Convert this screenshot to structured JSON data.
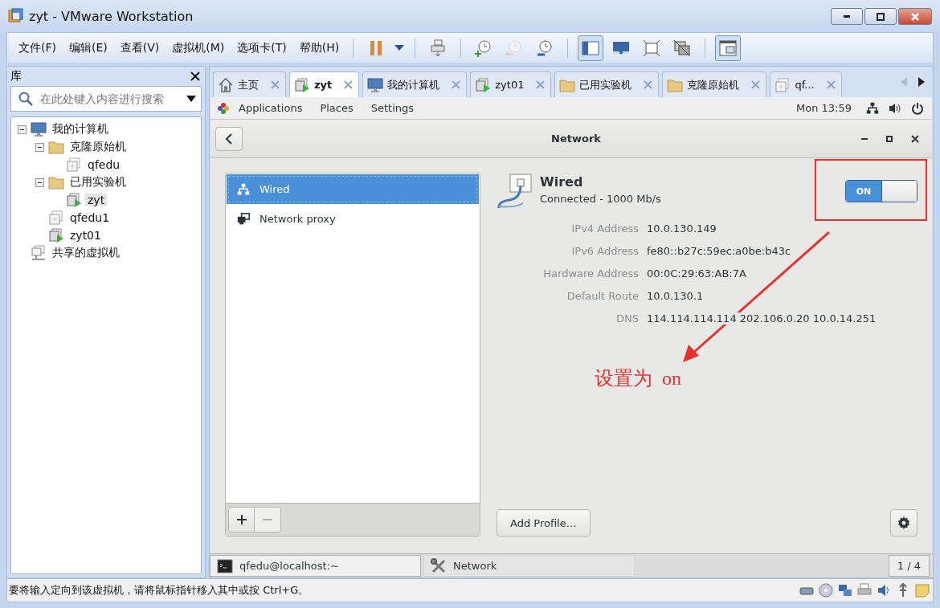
{
  "window": {
    "title": "zyt - VMware Workstation"
  },
  "menu": [
    "文件(F)",
    "编辑(E)",
    "查看(V)",
    "虚拟机(M)",
    "选项卡(T)",
    "帮助(H)"
  ],
  "toolbar": [
    [
      {
        "kind": "pause",
        "pressed": false,
        "disabled": false
      },
      {
        "kind": "dropdown",
        "pressed": false,
        "disabled": false
      }
    ],
    [
      {
        "kind": "send-keys",
        "pressed": false,
        "disabled": false
      }
    ],
    [
      {
        "kind": "snapshot-take",
        "pressed": false,
        "disabled": false
      },
      {
        "kind": "snapshot-revert",
        "pressed": false,
        "disabled": true
      },
      {
        "kind": "snapshot-manager",
        "pressed": false,
        "disabled": false
      }
    ],
    [
      {
        "kind": "library-view",
        "pressed": true,
        "disabled": false
      },
      {
        "kind": "console-view",
        "pressed": false,
        "disabled": false
      },
      {
        "kind": "full-screen",
        "pressed": false,
        "disabled": false
      },
      {
        "kind": "unity",
        "pressed": false,
        "disabled": false
      }
    ],
    [
      {
        "kind": "thumbnail-view",
        "pressed": true,
        "disabled": false
      }
    ]
  ],
  "library": {
    "title": "库",
    "search": {
      "placeholder": "在此处键入内容进行搜索"
    },
    "tree": [
      {
        "label": "我的计算机",
        "kind": "computer",
        "selected": false,
        "expanded": true,
        "children": [
          {
            "label": "克隆原始机",
            "kind": "folder",
            "selected": false,
            "expanded": true,
            "children": [
              {
                "label": "qfedu",
                "kind": "vm-off",
                "selected": false
              }
            ]
          },
          {
            "label": "已用实验机",
            "kind": "folder",
            "selected": false,
            "expanded": true,
            "children": [
              {
                "label": "zyt",
                "kind": "vm-running",
                "selected": true
              }
            ]
          },
          {
            "label": "qfedu1",
            "kind": "vm-off",
            "selected": false
          },
          {
            "label": "zyt01",
            "kind": "vm-running",
            "selected": false
          }
        ]
      },
      {
        "label": "共享的虚拟机",
        "kind": "shared",
        "selected": false
      }
    ]
  },
  "tabs": [
    {
      "label": "主页",
      "kind": "home",
      "selected": false
    },
    {
      "label": "zyt",
      "kind": "vm-running",
      "selected": true
    },
    {
      "label": "我的计算机",
      "kind": "computer",
      "selected": false
    },
    {
      "label": "zyt01",
      "kind": "vm-running",
      "selected": false
    },
    {
      "label": "已用实验机",
      "kind": "folder",
      "selected": false
    },
    {
      "label": "克隆原始机",
      "kind": "folder",
      "selected": false
    },
    {
      "label": "qf...",
      "kind": "vm-off",
      "selected": false
    }
  ],
  "guest": {
    "top_bar": {
      "menus": [
        "Applications",
        "Places",
        "Settings"
      ],
      "clock": "Mon 13:59"
    },
    "network": {
      "title": "Network",
      "devices": [
        {
          "label": "Wired",
          "kind": "wired",
          "selected": true
        },
        {
          "label": "Network proxy",
          "kind": "proxy",
          "selected": false
        }
      ],
      "list_buttons": [
        {
          "kind": "add",
          "disabled": false
        },
        {
          "kind": "remove",
          "disabled": true
        }
      ],
      "detail": {
        "name": "Wired",
        "status": "Connected - 1000 Mb/s",
        "switch": {
          "label": "ON",
          "on": true
        },
        "rows": [
          {
            "label": "IPv4 Address",
            "value": "10.0.130.149"
          },
          {
            "label": "IPv6 Address",
            "value": "fe80::b27c:59ec:a0be:b43c"
          },
          {
            "label": "Hardware Address",
            "value": "00:0C:29:63:AB:7A"
          },
          {
            "label": "Default Route",
            "value": "10.0.130.1"
          },
          {
            "label": "DNS",
            "value": "114.114.114.114 202.106.0.20 10.0.14.251"
          }
        ],
        "add_profile": "Add Profile…"
      }
    },
    "taskbar": {
      "items": [
        {
          "label": "qfedu@localhost:~",
          "kind": "terminal",
          "selected": false
        },
        {
          "label": "Network",
          "kind": "tools",
          "selected": true
        }
      ],
      "pager": "1 / 4"
    }
  },
  "annotation": {
    "text": "设置为  on"
  },
  "status_bar": {
    "message": "要将输入定向到该虚拟机，请将鼠标指针移入其中或按 Ctrl+G。",
    "devices": [
      {
        "kind": "disk"
      },
      {
        "kind": "cd"
      },
      {
        "kind": "network"
      },
      {
        "kind": "printer"
      },
      {
        "kind": "sound"
      },
      {
        "kind": "usb"
      },
      {
        "kind": "message"
      }
    ]
  }
}
